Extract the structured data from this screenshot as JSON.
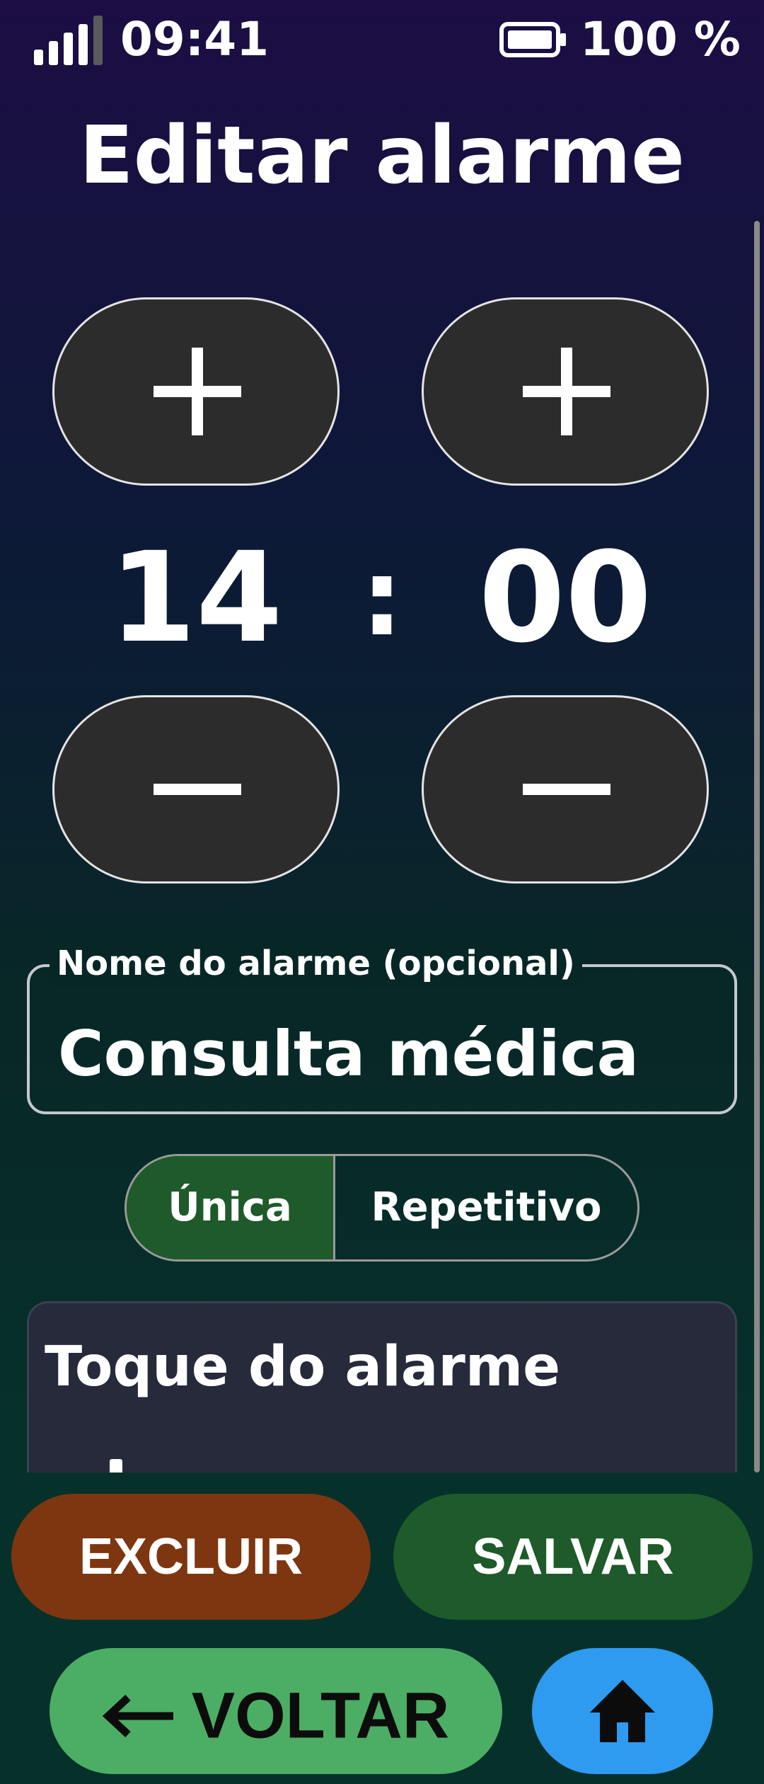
{
  "status_bar": {
    "time": "09:41",
    "battery_percent": "100 %",
    "signal_bars": 4,
    "icons": [
      "signal-icon",
      "battery-icon"
    ]
  },
  "header": {
    "title": "Editar alarme"
  },
  "time_picker": {
    "hours": "14",
    "separator": ":",
    "minutes": "00",
    "icons": [
      "plus-icon",
      "minus-icon"
    ]
  },
  "alarm_name": {
    "label": "Nome do alarme (opcional)",
    "value": "Consulta médica"
  },
  "recurrence": {
    "options": [
      "Única",
      "Repetitivo"
    ],
    "selected": "Única"
  },
  "ringtone": {
    "title": "Toque do alarme"
  },
  "actions": {
    "delete_label": "EXCLUIR",
    "save_label": "SALVAR",
    "back_label": "VOLTAR",
    "icons": [
      "arrow-left-icon",
      "home-icon"
    ]
  },
  "colors": {
    "background_top": "#1c0d44",
    "background_bottom": "#05312a",
    "stepper_fill": "#2c2c2c",
    "selected_segment": "#1e5a2a",
    "delete": "#7d3610",
    "save": "#1e5a2a",
    "back": "#4cae64",
    "home": "#2e9bf0"
  }
}
